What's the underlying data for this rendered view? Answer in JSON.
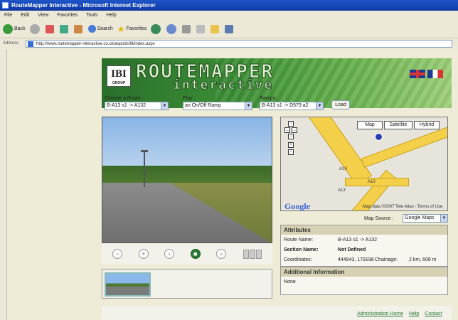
{
  "window": {
    "title": "RouteMapper Interactive - Microsoft Internet Explorer"
  },
  "menu": [
    "File",
    "Edit",
    "View",
    "Favorites",
    "Tools",
    "Help"
  ],
  "toolbar": {
    "back": "Back",
    "search": "Search",
    "favorites": "Favorites"
  },
  "address": {
    "label": "Address",
    "url": "http://www.routemapper-interactive.co.uk/aspnds08/index.aspx"
  },
  "brand": {
    "logo": "IBI",
    "logo_sub": "GROUP",
    "line1": "ROUTEMAPPER",
    "line2": "interactive"
  },
  "route_controls": {
    "route_label": "Choose a Route :",
    "route_value": "B-A13 s1 -> A132",
    "play_label": "Play :",
    "play_value": "an On/Off Ramp",
    "ramps_label": "Ramps:",
    "ramps_value": "B-A13 s1 -> D579 a2",
    "load": "Load"
  },
  "map": {
    "buttons": [
      "Map",
      "Satellite",
      "Hybrid"
    ],
    "road_labels": [
      "A13",
      "A13",
      "A13"
    ],
    "copyright": "Map data ©2007 Tele Atlas - Terms of Use",
    "logo": "Google",
    "source_label": "Map Source :",
    "source_value": "Google Maps"
  },
  "attributes": {
    "header": "Attributes",
    "route_name_label": "Route Name:",
    "route_name": "B-A13 s1 -> A132",
    "section_name_label": "Section Name:",
    "section_name": "Not Defined",
    "coordinates_label": "Coordinates:",
    "coordinates": "444943, 179198",
    "chainage_label": "Chainage:",
    "chainage": "2 km, 608 m"
  },
  "additional": {
    "header": "Additional Information",
    "value": "None"
  },
  "footer": {
    "links": [
      "Administration Home",
      "Help",
      "Contact"
    ]
  },
  "colors": {
    "brand_green": "#2a7a33",
    "map_road": "#f3cf4a"
  }
}
